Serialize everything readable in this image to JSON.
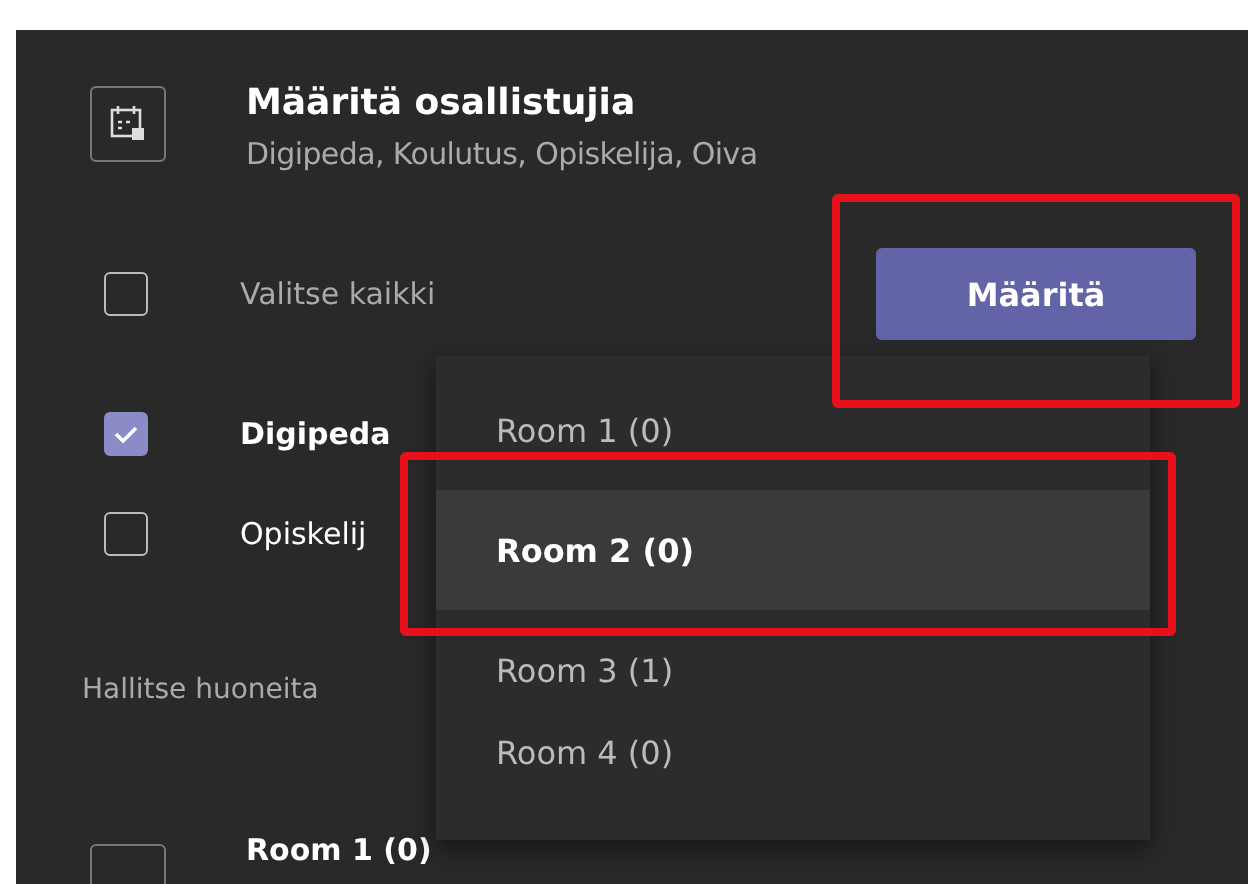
{
  "header": {
    "title": "Määritä osallistujia",
    "subtitle": "Digipeda, Koulutus, Opiskelija, Oiva"
  },
  "select_all": {
    "label": "Valitse kaikki",
    "checked": false
  },
  "assign_button": "Määritä",
  "participants": [
    {
      "label": "Digipeda",
      "checked": true
    },
    {
      "label": "Opiskelij",
      "checked": false
    }
  ],
  "manage_label": "Hallitse huoneita",
  "room": {
    "name": "Room 1 (0)"
  },
  "dropdown": [
    {
      "label": "Room 1 (0)",
      "selected": false
    },
    {
      "label": "Room 2 (0)",
      "selected": true
    },
    {
      "label": "Room 3 (1)",
      "selected": false
    },
    {
      "label": "Room 4 (0)",
      "selected": false
    }
  ],
  "annotations": [
    {
      "kind": "frame"
    },
    {
      "kind": "frame"
    }
  ]
}
